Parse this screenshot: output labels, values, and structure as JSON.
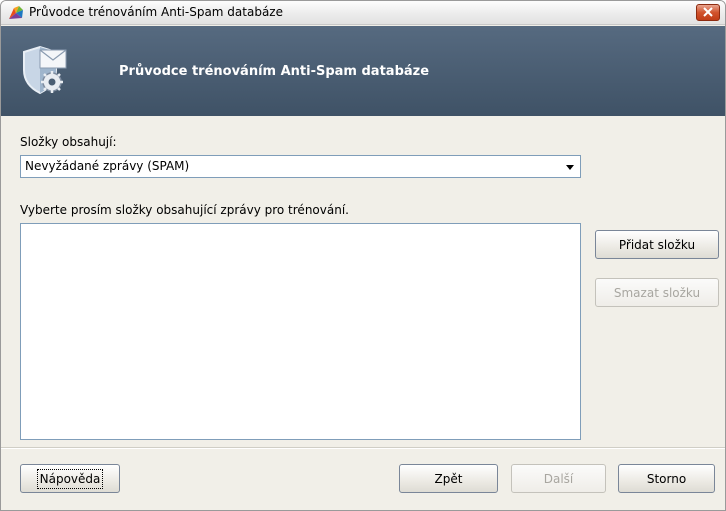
{
  "window": {
    "title": "Průvodce trénováním Anti-Spam databáze"
  },
  "banner": {
    "title": "Průvodce trénováním Anti-Spam databáze"
  },
  "form": {
    "folders_label": "Složky obsahují:",
    "folder_type_selected": "Nevyžádané zprávy (SPAM)",
    "instruction": "Vyberte prosím složky obsahující zprávy pro trénování.",
    "folder_list": []
  },
  "buttons": {
    "add_folder": "Přidat složku",
    "remove_folder": "Smazat složku",
    "help": "Nápověda",
    "back": "Zpět",
    "next": "Další",
    "cancel": "Storno"
  },
  "colors": {
    "banner": "#4b5e73",
    "window_bg": "#f1efe8",
    "close_button": "#d1532d"
  },
  "icons": {
    "app": "avg-logo-icon",
    "banner": "shield-envelope-gear-icon",
    "close": "close-icon",
    "dropdown": "chevron-down-icon"
  }
}
